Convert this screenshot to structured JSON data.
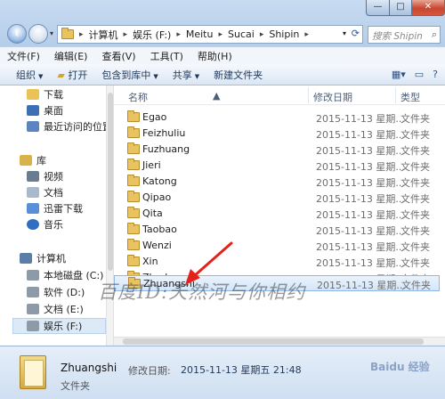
{
  "window_controls": {
    "minimize": "—",
    "maximize": "□",
    "close": "✕"
  },
  "address": {
    "crumbs": [
      "计算机",
      "娱乐 (F:)",
      "Meitu",
      "Sucai",
      "Shipin"
    ],
    "separator": "▸"
  },
  "search": {
    "placeholder": "搜索 Shipin",
    "icon": "search-icon"
  },
  "menu": [
    "文件(F)",
    "编辑(E)",
    "查看(V)",
    "工具(T)",
    "帮助(H)"
  ],
  "toolbar": {
    "organize": "组织",
    "open": "打开",
    "include_library": "包含到库中",
    "share": "共享",
    "new_folder": "新建文件夹"
  },
  "sidebar": {
    "items": [
      {
        "label": "下载",
        "icon": "downloads-icon"
      },
      {
        "label": "桌面",
        "icon": "desktop-icon"
      },
      {
        "label": "最近访问的位置",
        "icon": "recent-places-icon"
      },
      {
        "label": "库",
        "icon": "libraries-icon"
      },
      {
        "label": "视频",
        "icon": "videos-icon"
      },
      {
        "label": "文档",
        "icon": "documents-icon"
      },
      {
        "label": "迅雷下载",
        "icon": "thunder-download-icon"
      },
      {
        "label": "音乐",
        "icon": "music-icon"
      },
      {
        "label": "计算机",
        "icon": "computer-icon"
      },
      {
        "label": "本地磁盘 (C:)",
        "icon": "drive-icon"
      },
      {
        "label": "软件 (D:)",
        "icon": "drive-icon"
      },
      {
        "label": "文档 (E:)",
        "icon": "drive-icon"
      },
      {
        "label": "娱乐 (F:)",
        "icon": "drive-icon"
      }
    ]
  },
  "columns": {
    "name": "名称",
    "modified": "修改日期",
    "type": "类型"
  },
  "rows": [
    {
      "name": "Egao",
      "date": "2015-11-13 星期...",
      "type": "文件夹"
    },
    {
      "name": "Feizhuliu",
      "date": "2015-11-13 星期...",
      "type": "文件夹"
    },
    {
      "name": "Fuzhuang",
      "date": "2015-11-13 星期...",
      "type": "文件夹"
    },
    {
      "name": "Jieri",
      "date": "2015-11-13 星期...",
      "type": "文件夹"
    },
    {
      "name": "Katong",
      "date": "2015-11-13 星期...",
      "type": "文件夹"
    },
    {
      "name": "Qipao",
      "date": "2015-11-13 星期...",
      "type": "文件夹"
    },
    {
      "name": "Qita",
      "date": "2015-11-13 星期...",
      "type": "文件夹"
    },
    {
      "name": "Taobao",
      "date": "2015-11-13 星期...",
      "type": "文件夹"
    },
    {
      "name": "Wenzi",
      "date": "2015-11-13 星期...",
      "type": "文件夹"
    },
    {
      "name": "Xin",
      "date": "2015-11-13 星期...",
      "type": "文件夹"
    },
    {
      "name": "Zhedang",
      "date": "2015-11-13 星期...",
      "type": "文件夹"
    },
    {
      "name": "Zhuangshi",
      "date": "2015-11-13 星期...",
      "type": "文件夹"
    }
  ],
  "selected_row": "Zhuangshi",
  "watermark": "百度ID:天然河与你相约",
  "details": {
    "name": "Zhuangshi",
    "meta_label": "修改日期:",
    "date": "2015-11-13 星期五 21:48",
    "type": "文件夹"
  },
  "brand": "Baidu 经验",
  "colors": {
    "accent": "#8fb8e6",
    "arrow": "#e3231b",
    "folder": "#e8c35f"
  }
}
